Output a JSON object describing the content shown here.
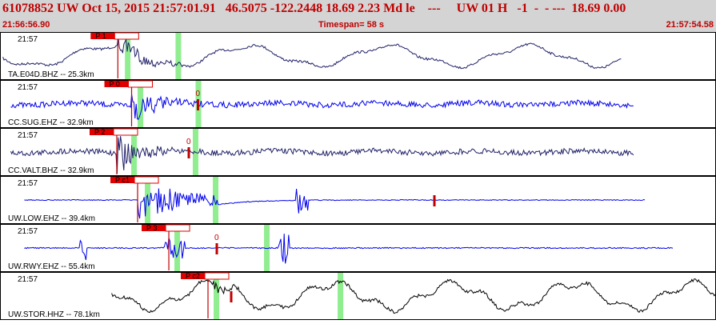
{
  "header": {
    "title": "61078852 UW Oct 15, 2015 21:57:01.91   46.5075 -122.2448 18.69 2.23 Md le    ---     UW 01 H   -1  -  - ---  18.69 0.00",
    "start_time": "21:56:56.90",
    "timespan": "Timespan=  58 s",
    "end_time": "21:57:54.58"
  },
  "colors": {
    "header_bg": "#d4d4d4",
    "header_text": "#c00000",
    "pick_box": "#e00000",
    "marker": "#c00000",
    "window": "#90ee90",
    "trace_navy": "#202068",
    "trace_blue": "#0000ee",
    "trace_black": "#000000"
  },
  "panels": [
    {
      "label": "TA.E04D.BHZ -- 25.3km",
      "time": "21:57",
      "color": "#202068",
      "trace_type": "lowfreq",
      "picks": [
        {
          "text": "P 1",
          "x": 0.1646
        }
      ],
      "windows": [
        0.1778,
        0.2485
      ],
      "marker": null,
      "x_start": 0.004,
      "x_end": 0.868
    },
    {
      "label": "CC.SUG.EHZ -- 32.9km",
      "time": "21:57",
      "color": "#0000ee",
      "trace_type": "noise",
      "picks": [
        {
          "text": "P 0",
          "x": 0.1838
        }
      ],
      "windows": [
        0.1955,
        0.2765
      ],
      "marker": {
        "text": "0",
        "x": 0.2765
      },
      "x_start": 0.015,
      "x_end": 0.885
    },
    {
      "label": "CC.VALT.BHZ -- 32.9km",
      "time": "21:57",
      "color": "#202068",
      "trace_type": "noise",
      "picks": [
        {
          "text": "P 2",
          "x": 0.1631
        }
      ],
      "windows": [
        0.1866,
        0.2726
      ],
      "marker": {
        "text": "0",
        "x": 0.2637
      },
      "x_start": 0.015,
      "x_end": 0.885
    },
    {
      "label": "UW.LOW.EHZ -- 39.4km",
      "time": "21:57",
      "color": "#0000ee",
      "trace_type": "lowflat",
      "picks": [
        {
          "text": "P c1",
          "x": 0.1922
        }
      ],
      "windows": [
        0.2056,
        0.3006
      ],
      "marker": {
        "text": "",
        "x": 0.6067
      },
      "x_start": 0.034,
      "x_end": 0.902
    },
    {
      "label": "UW.RWY.EHZ -- 55.4km",
      "time": "21:57",
      "color": "#0000ee",
      "trace_type": "rwy",
      "picks": [
        {
          "text": "P 3",
          "x": 0.2358
        }
      ],
      "windows": [
        0.2469,
        0.3721
      ],
      "marker": {
        "text": "0",
        "x": 0.3028
      },
      "x_start": 0.034,
      "x_end": 0.941
    },
    {
      "label": "UW.STOR.HHZ -- 78.1km",
      "time": "21:57",
      "color": "#000000",
      "trace_type": "stor",
      "picks": [
        {
          "text": "P c2",
          "x": 0.2905
        }
      ],
      "windows": [
        0.3017,
        0.4749
      ],
      "marker": {
        "text": "",
        "x": 0.3229
      },
      "x_start": 0.156,
      "x_end": 1.0
    }
  ]
}
